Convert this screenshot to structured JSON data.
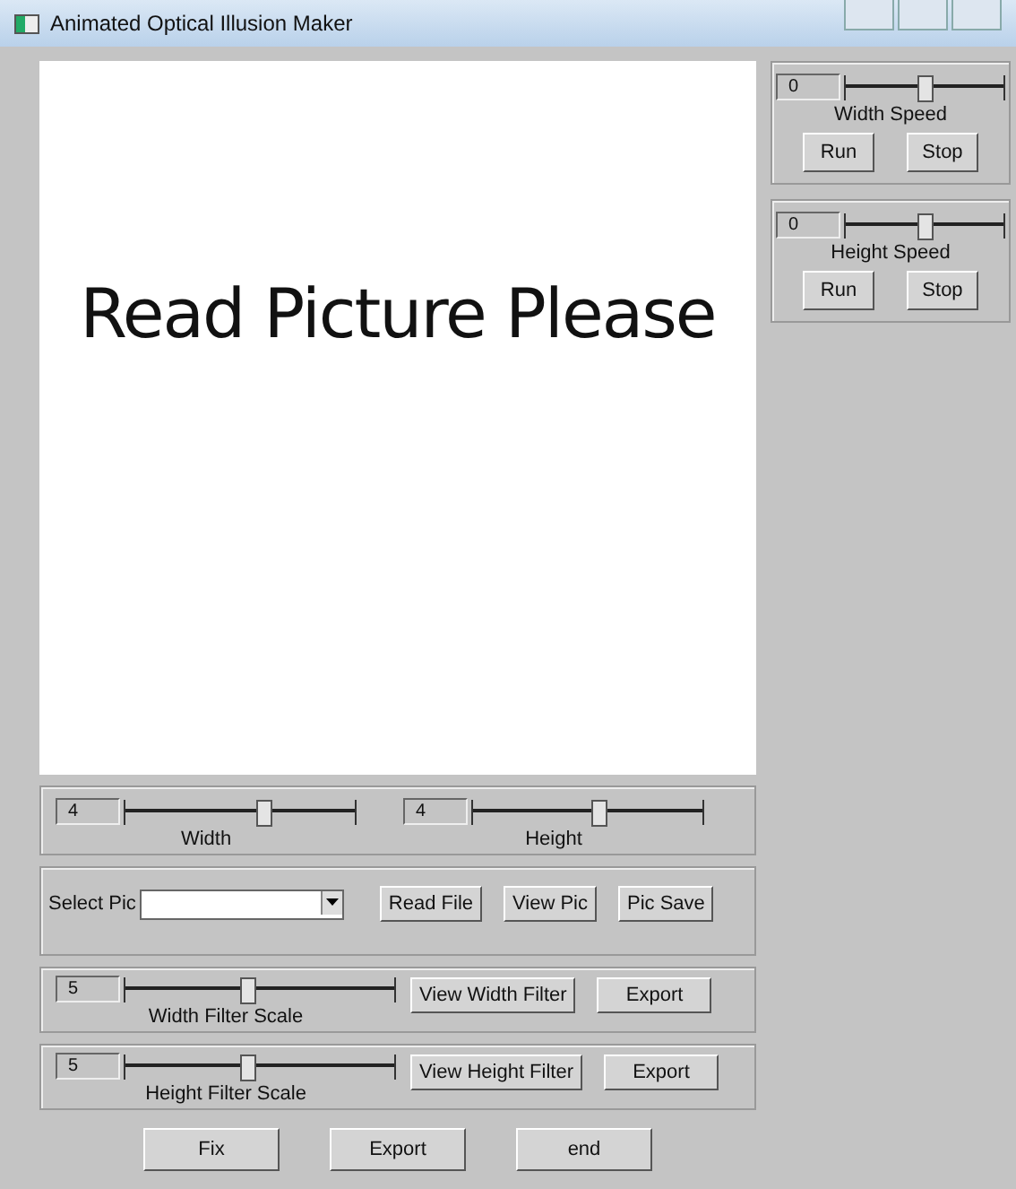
{
  "window": {
    "title": "Animated Optical Illusion Maker"
  },
  "canvas": {
    "message": "Read Picture Please"
  },
  "speed_panels": [
    {
      "value": "0",
      "level": 0.5,
      "label": "Width Speed",
      "buttons": [
        "Run",
        "Stop"
      ]
    },
    {
      "value": "0",
      "level": 0.5,
      "label": "Height Speed",
      "buttons": [
        "Run",
        "Stop"
      ]
    }
  ],
  "size_sliders": [
    {
      "value": "4",
      "level": 0.6,
      "label": "Width"
    },
    {
      "value": "4",
      "level": 0.55,
      "label": "Height"
    }
  ],
  "select_row": {
    "label": "Select Pic",
    "buttons": [
      "Read File",
      "View Pic",
      "Pic Save"
    ]
  },
  "filter_panels": [
    {
      "value": "5",
      "level": 0.45,
      "label": "Width Filter Scale",
      "buttons": [
        "View Width Filter",
        "Export"
      ]
    },
    {
      "value": "5",
      "level": 0.45,
      "label": "Height Filter Scale",
      "buttons": [
        "View Height Filter",
        "Export"
      ]
    }
  ],
  "bottom_buttons": [
    "Fix",
    "Export",
    "end"
  ]
}
